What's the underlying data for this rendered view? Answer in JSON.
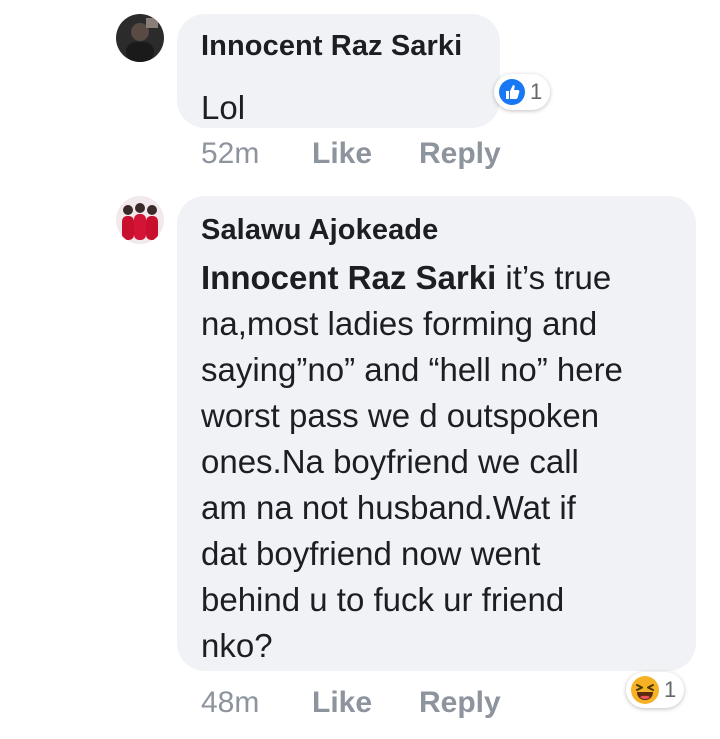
{
  "comments": [
    {
      "author": "Innocent Raz Sarki",
      "text": "Lol",
      "reaction": {
        "icon": "like-icon",
        "count": "1",
        "color": "#1877f2"
      },
      "time": "52m",
      "like_label": "Like",
      "reply_label": "Reply"
    },
    {
      "author": "Salawu Ajokeade",
      "mention": "Innocent Raz Sarki",
      "text_lines": [
        " it’s true",
        "na,most ladies forming and",
        "saying”no” and “hell no” here",
        "worst pass we d outspoken",
        "ones.Na boyfriend we call",
        "am na not husband.Wat if",
        "dat boyfriend now went",
        "behind u to fuck ur friend",
        "nko?"
      ],
      "reaction": {
        "icon": "haha-emoji-icon",
        "count": "1",
        "color": "#f7b125"
      },
      "time": "48m",
      "like_label": "Like",
      "reply_label": "Reply"
    }
  ]
}
